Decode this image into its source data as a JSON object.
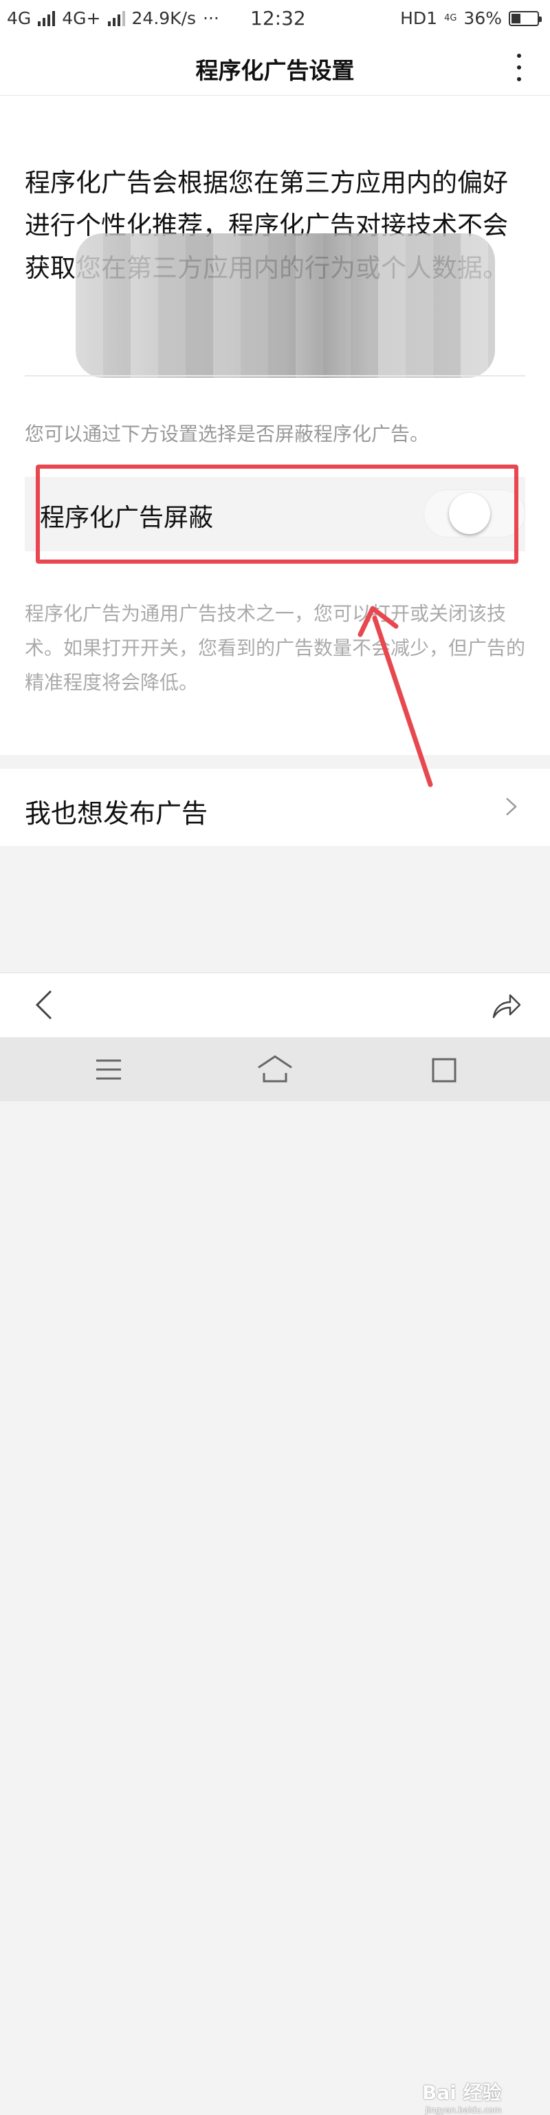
{
  "status_bar": {
    "network1": "4G",
    "network2": "4G+",
    "speed": "24.9K/s",
    "dots": "···",
    "time": "12:32",
    "hd": "HD1",
    "network3": "4G",
    "battery_percent": "36%",
    "battery_level": 0.36
  },
  "header": {
    "title": "程序化广告设置",
    "more_icon": "more-vertical-icon"
  },
  "main": {
    "intro_text": "程序化广告会根据您在第三方应用内的偏好进行个性化推荐，程序化广告对接技术不会获取您在第三方应用内的行为或个人数据。",
    "hint_text": "您可以通过下方设置选择是否屏蔽程序化广告。",
    "toggle": {
      "label": "程序化广告屏蔽",
      "state": "off"
    },
    "description": "程序化广告为通用广告技术之一，您可以打开或关闭该技术。如果打开开关，您看到的广告数量不会减少，但广告的精准程度将会降低。"
  },
  "publish_row": {
    "label": "我也想发布广告",
    "icon": "chevron-right-icon"
  },
  "bottom_nav": {
    "back_icon": "back-icon",
    "share_icon": "share-icon"
  },
  "system_nav": {
    "menu_icon": "menu-icon",
    "home_icon": "home-icon",
    "recent_icon": "recent-apps-icon"
  },
  "watermark": {
    "text": "Bai 经验",
    "subtext": "jingyan.baidu.com"
  },
  "colors": {
    "annotation_red": "#e8474f",
    "background": "#f3f3f3"
  }
}
